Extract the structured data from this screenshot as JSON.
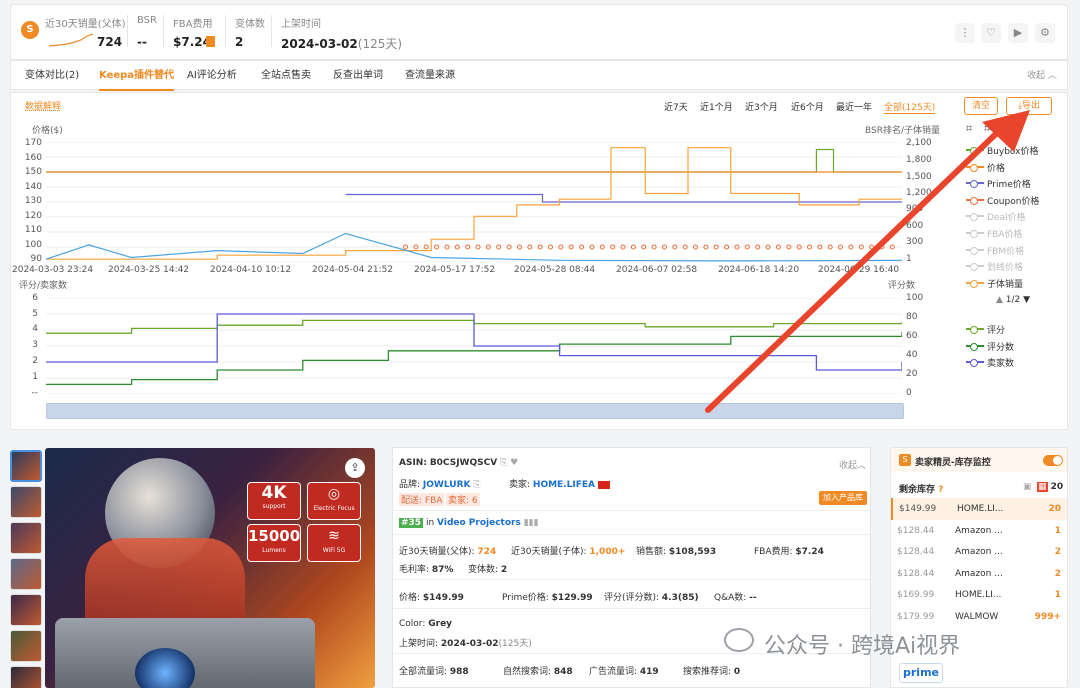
{
  "stats": {
    "sales_label": "近30天销量(父体)",
    "sales_value": "724",
    "bsr_label": "BSR",
    "bsr_value": "--",
    "fba_label": "FBA费用",
    "fba_value": "$7.24",
    "variants_label": "变体数",
    "variants_value": "2",
    "launch_label": "上架时间",
    "launch_value": "2024-03-02",
    "launch_days": "(125天)"
  },
  "tabs": [
    "变体对比(2)",
    "Keepa插件替代",
    "AI评论分析",
    "全站点售卖",
    "反查出单词",
    "查流量来源"
  ],
  "collapse_label": "收起",
  "chart_header": {
    "explain": "数据解释",
    "ranges": [
      "近7天",
      "近1个月",
      "近3个月",
      "近6个月",
      "最近一年",
      "全部(125天)"
    ],
    "clear": "清空",
    "export": "导出"
  },
  "chart_data": [
    {
      "type": "line",
      "ylabel": "价格($)",
      "y2label": "BSR排名/子体销量",
      "y_ticks": [
        "170",
        "160",
        "150",
        "140",
        "130",
        "120",
        "110",
        "100",
        "90"
      ],
      "y2_ticks": [
        "2,100",
        "1,800",
        "1,500",
        "1,200",
        "900",
        "600",
        "300",
        "1"
      ],
      "ylim": [
        90,
        170
      ],
      "y2lim": [
        1,
        2100
      ],
      "x_ticks": [
        "2024-03-03 23:24",
        "2024-03-25 14:42",
        "2024-04-10 10:12",
        "2024-05-04 21:52",
        "2024-05-17 17:52",
        "2024-05-28 08:44",
        "2024-06-07 02:58",
        "2024-06-18 14:20",
        "2024-06-29 16:40"
      ],
      "series": [
        {
          "name": "Buybox价格",
          "color": "#6aa82e",
          "axis": "left",
          "x": [
            0,
            0.9,
            0.9,
            0.92,
            0.92,
            1
          ],
          "y": [
            150,
            150,
            165,
            165,
            150,
            150
          ]
        },
        {
          "name": "价格",
          "color": "#f08a24",
          "axis": "left",
          "x": [
            0,
            0.44,
            0.44,
            1
          ],
          "y": [
            150,
            150,
            150,
            150
          ]
        },
        {
          "name": "Prime价格",
          "color": "#6666cc",
          "axis": "left",
          "x": [
            0.35,
            0.58,
            0.58,
            1
          ],
          "y": [
            135,
            135,
            130,
            130
          ]
        },
        {
          "name": "Coupon价格",
          "color": "#e8703a",
          "axis": "left",
          "x": [
            0.42,
            0.5,
            0.6,
            0.7,
            0.8,
            0.9,
            1
          ],
          "y": [
            100,
            100,
            100,
            100,
            100,
            100,
            100
          ]
        },
        {
          "name": "子体销量",
          "color": "#f5a33a",
          "axis": "right",
          "x": [
            0,
            0.2,
            0.35,
            0.45,
            0.5,
            0.55,
            0.6,
            0.66,
            0.7,
            0.75,
            0.8,
            0.88,
            0.95,
            1
          ],
          "y": [
            50,
            120,
            200,
            400,
            800,
            1000,
            1100,
            2000,
            1200,
            2000,
            1200,
            1000,
            1100,
            1100
          ]
        },
        {
          "name": "BSR",
          "color": "#4aa3e0",
          "axis": "right",
          "x": [
            0,
            0.05,
            0.1,
            0.2,
            0.3,
            0.35,
            0.45,
            0.6,
            0.8,
            1
          ],
          "y": [
            50,
            300,
            80,
            200,
            150,
            500,
            80,
            30,
            20,
            30
          ]
        }
      ]
    },
    {
      "type": "line",
      "ylabel": "评分/卖家数",
      "y2label": "评分数",
      "y_ticks": [
        "6",
        "5",
        "4",
        "3",
        "2",
        "1",
        "--"
      ],
      "y2_ticks": [
        "100",
        "80",
        "60",
        "40",
        "20",
        "0"
      ],
      "ylim": [
        0,
        6
      ],
      "y2lim": [
        0,
        100
      ],
      "series": [
        {
          "name": "评分",
          "color": "#6aa82e",
          "axis": "left",
          "x": [
            0,
            0.1,
            0.2,
            0.3,
            0.5,
            0.7,
            0.85,
            1
          ],
          "y": [
            3.8,
            4.1,
            4.3,
            4.6,
            4.4,
            4.2,
            4.4,
            4.5
          ]
        },
        {
          "name": "评分数",
          "color": "#2e8b2e",
          "axis": "right",
          "x": [
            0,
            0.1,
            0.2,
            0.3,
            0.4,
            0.6,
            0.8,
            1
          ],
          "y": [
            10,
            15,
            25,
            35,
            45,
            52,
            60,
            65
          ]
        },
        {
          "name": "卖家数",
          "color": "#5b5bd6",
          "axis": "left",
          "x": [
            0,
            0.2,
            0.2,
            0.5,
            0.5,
            0.6,
            0.6,
            0.9,
            0.9,
            1
          ],
          "y": [
            2,
            2,
            5,
            5,
            3,
            3,
            2.4,
            2.4,
            1.5,
            2
          ]
        }
      ]
    }
  ],
  "legend_top": [
    {
      "label": "Buybox价格",
      "color": "#6aa82e",
      "on": true
    },
    {
      "label": "价格",
      "color": "#f08a24",
      "on": true
    },
    {
      "label": "Prime价格",
      "color": "#6666cc",
      "on": true
    },
    {
      "label": "Coupon价格",
      "color": "#e8703a",
      "on": true
    },
    {
      "label": "Deal价格",
      "color": "#cccccc",
      "on": false
    },
    {
      "label": "FBA价格",
      "color": "#cccccc",
      "on": false
    },
    {
      "label": "FBM价格",
      "color": "#cccccc",
      "on": false
    },
    {
      "label": "划线价格",
      "color": "#cccccc",
      "on": false
    },
    {
      "label": "子体销量",
      "color": "#f5a33a",
      "on": true
    }
  ],
  "legend_pager": "1/2",
  "legend_bottom": [
    {
      "label": "评分",
      "color": "#6aa82e",
      "on": true
    },
    {
      "label": "评分数",
      "color": "#2e8b2e",
      "on": true
    },
    {
      "label": "卖家数",
      "color": "#5b5bd6",
      "on": true
    }
  ],
  "product_badges": {
    "res": "4K",
    "res_sub": "support",
    "focus": "Electric Focus",
    "lumens": "15000",
    "lumens_sub": "Lumens",
    "wifi": "WiFi 5G"
  },
  "info": {
    "asin_label": "ASIN:",
    "asin": "B0CSJWQSCV",
    "collapse": "收起",
    "brand_label": "品牌:",
    "brand": "JOWLURK",
    "seller_label": "卖家:",
    "seller": "HOME.LIFEA",
    "ship_tag": "配送: FBA",
    "sellers_tag": "卖家: 6",
    "add_btn": "加入产品库",
    "rank": "#35",
    "rank_in": "in",
    "rank_cat": "Video Projectors",
    "r1": [
      {
        "k": "近30天销量(父体):",
        "v": "724",
        "cls": "org"
      },
      {
        "k": "近30天销量(子体):",
        "v": "1,000+",
        "cls": "org"
      },
      {
        "k": "销售额:",
        "v": "$108,593",
        "cls": ""
      },
      {
        "k": "FBA费用:",
        "v": "$7.24",
        "cls": ""
      }
    ],
    "r2": [
      {
        "k": "毛利率:",
        "v": "87%"
      },
      {
        "k": "变体数:",
        "v": "2"
      }
    ],
    "r3": [
      {
        "k": "价格:",
        "v": "$149.99"
      },
      {
        "k": "Prime价格:",
        "v": "$129.99"
      },
      {
        "k": "评分(评分数):",
        "v": "4.3(85)"
      },
      {
        "k": "Q&A数:",
        "v": "--"
      }
    ],
    "color_label": "Color:",
    "color": "Grey",
    "launch_label": "上架时间:",
    "launch": "2024-03-02",
    "launch_days": "(125天)",
    "r4": [
      {
        "k": "全部流量词:",
        "v": "988"
      },
      {
        "k": "自然搜索词:",
        "v": "848"
      },
      {
        "k": "广告流量词:",
        "v": "419"
      },
      {
        "k": "搜索推荐词:",
        "v": "0"
      }
    ]
  },
  "stock": {
    "title": "卖家精灵-库存监控",
    "remain_label": "剩余库存",
    "remain_count": "20",
    "rows": [
      {
        "price": "$149.99",
        "seller": "HOME.LI...",
        "qty": "20",
        "hl": true
      },
      {
        "price": "$128.44",
        "seller": "Amazon ...",
        "qty": "1",
        "hl": false
      },
      {
        "price": "$128.44",
        "seller": "Amazon ...",
        "qty": "2",
        "hl": false
      },
      {
        "price": "$128.44",
        "seller": "Amazon ...",
        "qty": "2",
        "hl": false
      },
      {
        "price": "$169.99",
        "seller": "HOME.LI...",
        "qty": "1",
        "hl": false
      },
      {
        "price": "$179.99",
        "seller": "WALMOW",
        "qty": "999+",
        "hl": false
      }
    ],
    "prime": "prime"
  },
  "watermark": {
    "text": "公众号 · 跨境Ai视界"
  },
  "colors": {
    "accent": "#f08a24",
    "arrow": "#e8452c",
    "link": "#1a6ecc"
  }
}
